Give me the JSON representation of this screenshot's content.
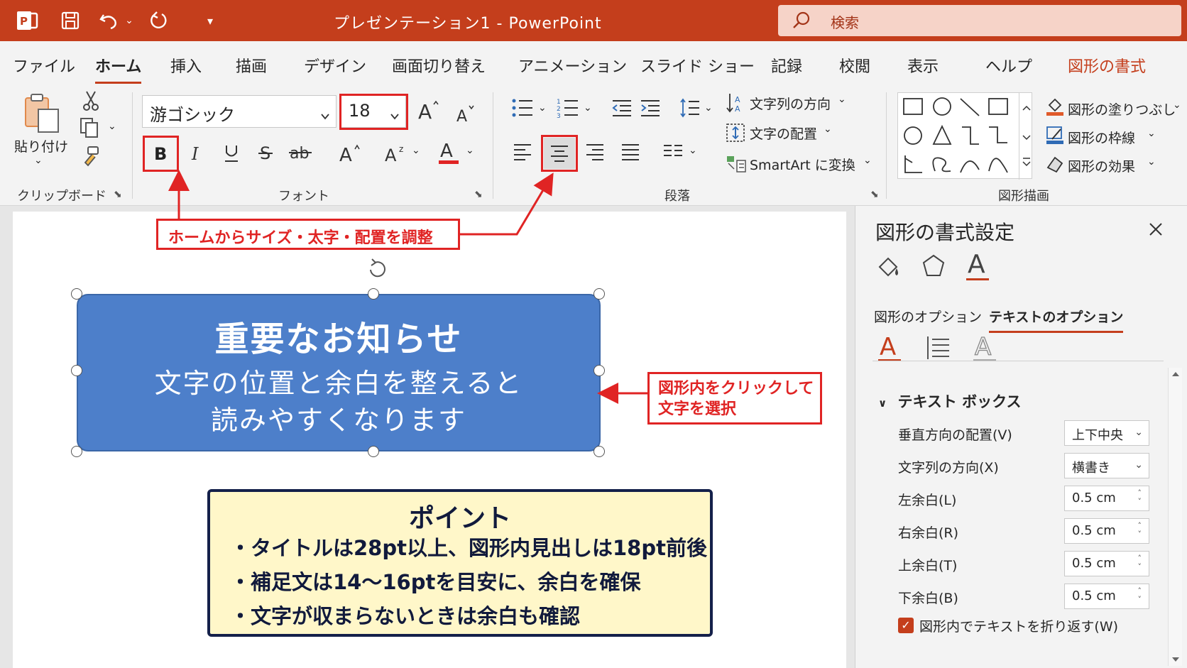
{
  "window": {
    "title": "プレゼンテーション1 - PowerPoint",
    "search_label": "検索"
  },
  "tabs": [
    {
      "label": "ファイル"
    },
    {
      "label": "ホーム"
    },
    {
      "label": "挿入"
    },
    {
      "label": "描画"
    },
    {
      "label": "デザイン"
    },
    {
      "label": "画面切り替え"
    },
    {
      "label": "アニメーション"
    },
    {
      "label": "スライド ショー"
    },
    {
      "label": "記録"
    },
    {
      "label": "校閲"
    },
    {
      "label": "表示"
    },
    {
      "label": "ヘルプ"
    },
    {
      "label": "図形の書式"
    }
  ],
  "ribbon": {
    "clipboard": {
      "paste_label": "貼り付け",
      "group_label": "クリップボード"
    },
    "font": {
      "font_name": "游ゴシック",
      "font_size": "18",
      "group_label": "フォント"
    },
    "paragraph": {
      "text_direction": "文字列の方向",
      "text_align": "文字の配置",
      "smartart": "SmartArt に変換",
      "group_label": "段落"
    },
    "drawing": {
      "fill": "図形の塗りつぶし",
      "outline": "図形の枠線",
      "effects": "図形の効果",
      "group_label": "図形描画"
    }
  },
  "annotations": {
    "top_callout": "ホームからサイズ・太字・配置を調整",
    "right_callout_line1": "図形内をクリックして",
    "right_callout_line2": "文字を選択"
  },
  "slide": {
    "shape_title": "重要なお知らせ",
    "shape_body_line1": "文字の位置と余白を整えると",
    "shape_body_line2": "読みやすくなります",
    "point_title": "ポイント",
    "points": [
      "・タイトルは28pt以上、図形内見出しは18pt前後",
      "・補足文は14〜16ptを目安に、余白を確保",
      "・文字が収まらないときは余白も確認"
    ]
  },
  "pane": {
    "title": "図形の書式設定",
    "tab_shape_options": "図形のオプション",
    "tab_text_options": "テキストのオプション",
    "section": "テキスト ボックス",
    "props": [
      {
        "label": "垂直方向の配置(V)",
        "value": "上下中央",
        "kind": "dropdown"
      },
      {
        "label": "文字列の方向(X)",
        "value": "横書き",
        "kind": "dropdown"
      },
      {
        "label": "左余白(L)",
        "value": "0.5 cm",
        "kind": "spin"
      },
      {
        "label": "右余白(R)",
        "value": "0.5 cm",
        "kind": "spin"
      },
      {
        "label": "上余白(T)",
        "value": "0.5 cm",
        "kind": "spin"
      },
      {
        "label": "下余白(B)",
        "value": "0.5 cm",
        "kind": "spin"
      }
    ],
    "wrap_text": "図形内でテキストを折り返す(W)",
    "wrap_checked": true
  },
  "colors": {
    "accent": "#c43e1c",
    "shape_fill": "#4d7fca",
    "callout": "#e02424",
    "point_fill": "#fff7c9"
  }
}
